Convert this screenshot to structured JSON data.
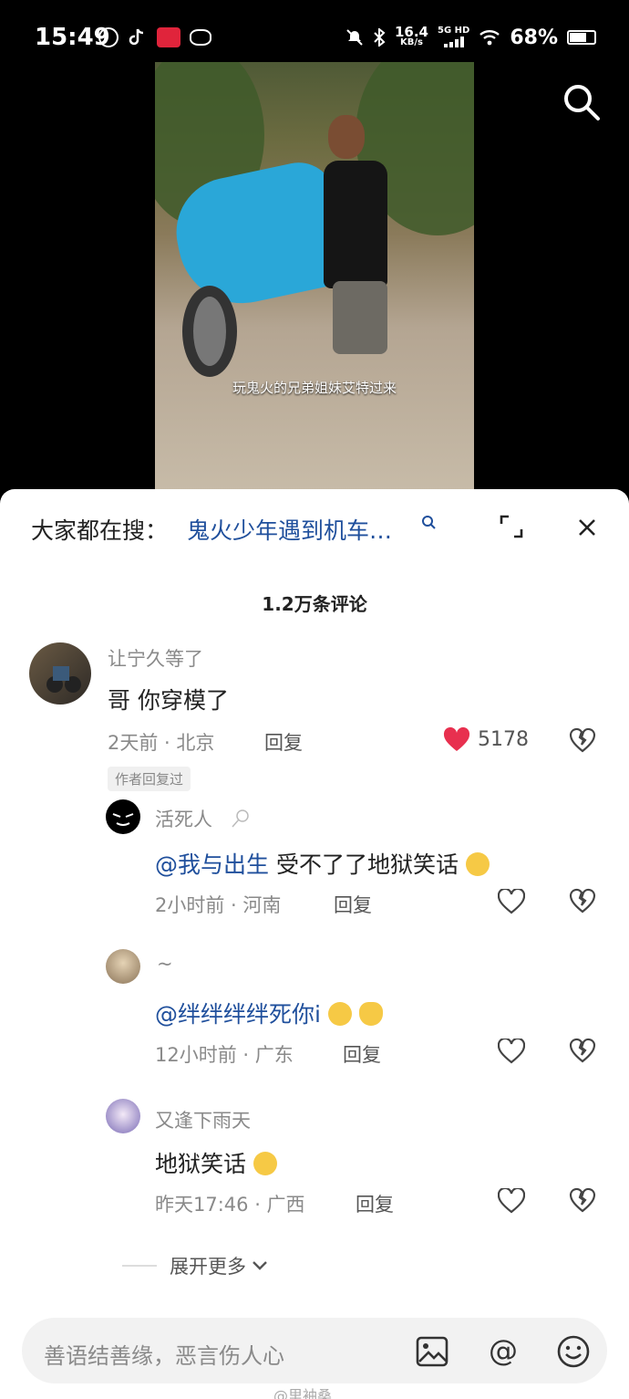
{
  "status_bar": {
    "time": "15:49",
    "network_speed_top": "16.4",
    "network_speed_unit": "KB/s",
    "signal_label": "5G HD",
    "battery": "68%",
    "battery_level": 0.68
  },
  "video": {
    "caption": "玩鬼火的兄弟姐妹艾特过来"
  },
  "sheet": {
    "trending_prefix": "大家都在搜：",
    "trending_query": "鬼火少年遇到机车…",
    "comment_count": "1.2万条评论"
  },
  "comments": {
    "main": {
      "username": "让宁久等了",
      "text": "哥 你穿模了",
      "time_location": "2天前 · 北京",
      "reply_label": "回复",
      "likes": "5178",
      "author_badge": "作者回复过"
    },
    "replies": [
      {
        "username": "活死人",
        "mention": "@我与出生",
        "text": " 受不了了地狱笑话",
        "time_location": "2小时前 · 河南",
        "reply_label": "回复"
      },
      {
        "username": "~",
        "mention": "@绊绊绊绊死你i",
        "text": "",
        "time_location": "12小时前 · 广东",
        "reply_label": "回复"
      },
      {
        "username": "又逢下雨天",
        "mention": "",
        "text": "地狱笑话",
        "time_location": "昨天17:46 · 广西",
        "reply_label": "回复"
      }
    ],
    "expand_more": "展开更多"
  },
  "input": {
    "placeholder": "善语结善缘，恶言伤人心"
  },
  "watermark": "@里袖桑",
  "colors": {
    "mention": "#1f4f9c",
    "like_red": "#e8304f",
    "scooter": "#2aa7d8"
  }
}
